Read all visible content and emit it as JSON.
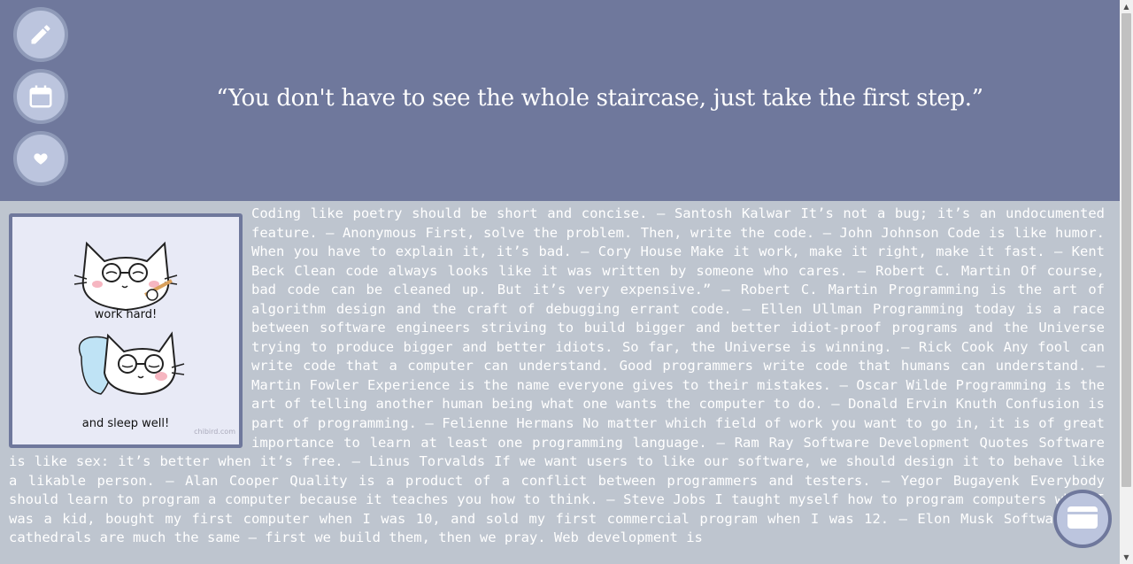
{
  "header": {
    "quote": "“You don't have to see the whole staircase, just take the first step.”"
  },
  "sidebar": {
    "buttons": [
      {
        "icon": "pencil-icon"
      },
      {
        "icon": "calendar-icon"
      },
      {
        "icon": "heart-icon"
      }
    ]
  },
  "sticker": {
    "caption_top": "work hard!",
    "caption_bottom": "and sleep well!",
    "credit": "chibird.com"
  },
  "content": {
    "quotes_text": "Coding like poetry should be short and concise. ― Santosh Kalwar It’s not a bug; it’s an undocumented feature. ― Anonymous First, solve the problem. Then, write the code. – John Johnson Code is like humor. When you have to explain it, it’s bad. – Cory House Make it work, make it right, make it fast. – Kent Beck Clean code always looks like it was written by someone who cares. ― Robert C. Martin Of course, bad code can be cleaned up. But it’s very expensive.” ― Robert C. Martin Programming is the art of algorithm design and the craft of debugging errant code. – Ellen Ullman Programming today is a race between software engineers striving to build bigger and better idiot-proof programs and the Universe trying to produce bigger and better idiots. So far, the Universe is winning. ― Rick Cook Any fool can write code that a computer can understand. Good programmers write code that humans can understand. ― Martin Fowler Experience is the name everyone gives to their mistakes. – Oscar Wilde Programming is the art of telling another human being what one wants the computer to do. ― Donald Ervin Knuth Confusion is part of programming. ― Felienne Hermans No matter which field of work you want to go in, it is of great importance to learn at least one programming language. ― Ram Ray Software Development Quotes Software is like sex: it’s better when it’s free. – Linus Torvalds If we want users to like our software, we should design it to behave like a likable person. – Alan Cooper Quality is a product of a conflict between programmers and testers. ― Yegor Bugayenk Everybody should learn to program a computer because it teaches you how to think. – Steve Jobs I taught myself how to program computers when I was a kid, bought my first computer when I was 10, and sold my first commercial program when I was 12. – Elon Musk Software and cathedrals are much the same – first we build them, then we pray. Web development is"
  },
  "fab": {
    "icon": "folder-icon"
  },
  "colors": {
    "header_bg": "#6f789c",
    "body_bg": "#bec5cf",
    "button_fill": "#bcc5de"
  }
}
